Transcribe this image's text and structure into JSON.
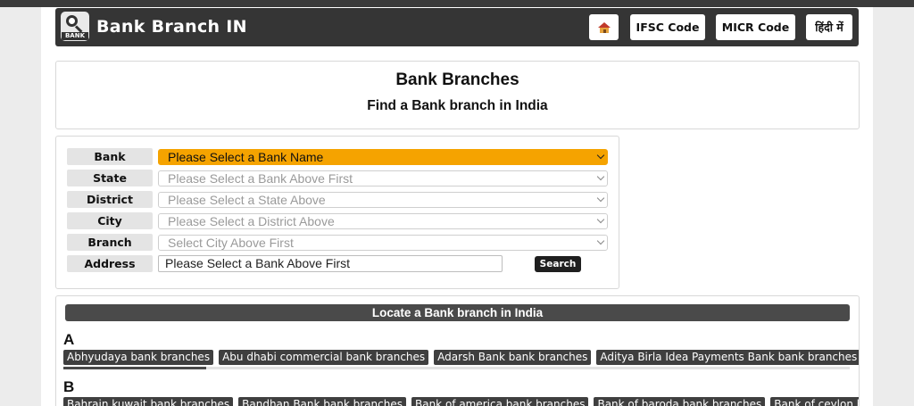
{
  "header": {
    "site_title": "Bank Branch IN",
    "logo_tag": "BANK",
    "nav": [
      {
        "label": "",
        "icon": "home-icon"
      },
      {
        "label": "IFSC Code"
      },
      {
        "label": "MICR Code"
      },
      {
        "label": "हिंदी में"
      }
    ]
  },
  "hero": {
    "title": "Bank Branches",
    "subtitle": "Find a Bank branch in India"
  },
  "form": {
    "bank_label": "Bank",
    "bank_value": "Please Select a Bank Name",
    "state_label": "State",
    "state_value": "Please Select a Bank Above First",
    "district_label": "District",
    "district_value": "Please Select a State Above",
    "city_label": "City",
    "city_value": "Please Select a District Above",
    "branch_label": "Branch",
    "branch_value": "Select City Above First",
    "address_label": "Address",
    "address_placeholder": "Please Select a Bank Above First",
    "search_label": "Search"
  },
  "locate": {
    "title": "Locate a Bank branch in India",
    "groups": [
      {
        "letter": "A",
        "items": [
          "Abhyudaya bank branches",
          "Abu dhabi commercial bank branches",
          "Adarsh Bank bank branches",
          "Aditya Birla Idea Payments Bank bank branches"
        ]
      },
      {
        "letter": "B",
        "items": [
          "Bahrain kuwait bank branches",
          "Bandhan Bank bank branches",
          "Bank of america bank branches",
          "Bank of baroda bank branches",
          "Bank of ceylon b"
        ]
      }
    ]
  },
  "colors": {
    "header_bg": "#353535",
    "accent_select": "#f5a300",
    "chip_bg": "#3f3f3f"
  }
}
